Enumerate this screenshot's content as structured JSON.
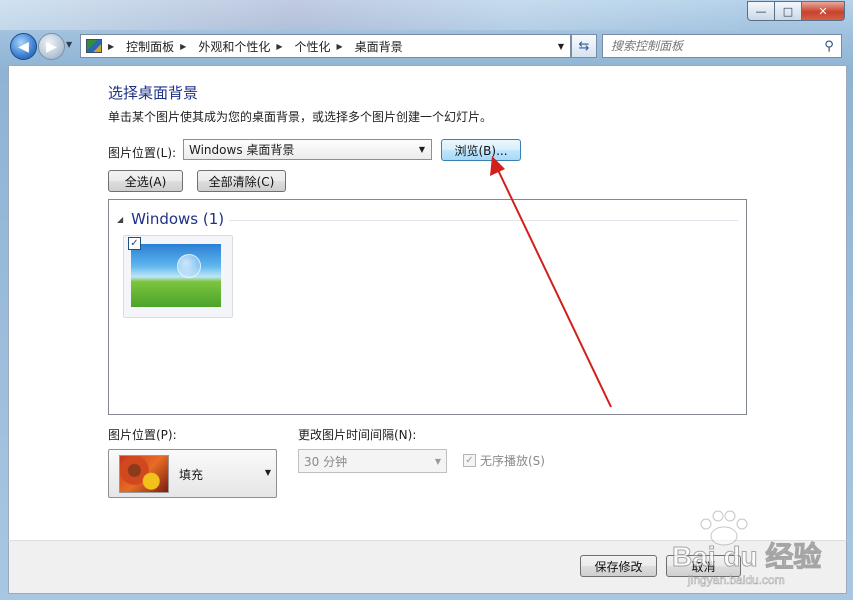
{
  "window": {
    "caption_buttons": {
      "minimize": "—",
      "maximize": "□",
      "close": "✕"
    }
  },
  "nav": {
    "back_icon": "left-arrow",
    "forward_icon": "right-arrow",
    "breadcrumbs": [
      "控制面板",
      "外观和个性化",
      "个性化",
      "桌面背景"
    ],
    "search_placeholder": "搜索控制面板"
  },
  "page": {
    "title": "选择桌面背景",
    "subtitle": "单击某个图片使其成为您的桌面背景，或选择多个图片创建一个幻灯片。",
    "picture_location_label": "图片位置(L):",
    "picture_location_value": "Windows 桌面背景",
    "browse_label": "浏览(B)...",
    "select_all_label": "全选(A)",
    "clear_all_label": "全部清除(C)",
    "group_title": "Windows (1)",
    "thumbnail_checked": true,
    "position_label": "图片位置(P):",
    "position_value": "填充",
    "interval_label": "更改图片时间间隔(N):",
    "interval_value": "30 分钟",
    "shuffle_label": "无序播放(S)",
    "shuffle_checked": true,
    "save_label": "保存修改",
    "cancel_label": "取消"
  },
  "annotation": {
    "color": "#d0201c"
  },
  "watermark": {
    "text": "Bai du 经验",
    "sub": "jingyan.baidu.com"
  }
}
